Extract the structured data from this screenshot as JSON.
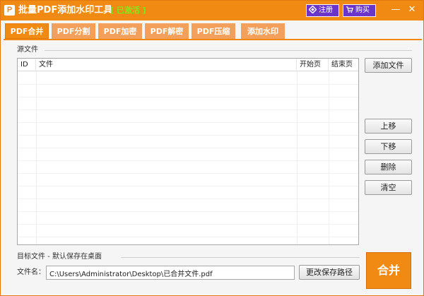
{
  "window": {
    "logo_letter": "P",
    "title": "批量PDF添加水印工具",
    "status": "[ 已激活 ]",
    "register_label": "注册",
    "buy_label": "购买",
    "minimize_glyph": "—",
    "close_glyph": "✕"
  },
  "tabs": [
    {
      "label": "PDF合并",
      "active": true
    },
    {
      "label": "PDF分割",
      "active": false
    },
    {
      "label": "PDF加密",
      "active": false
    },
    {
      "label": "PDF解密",
      "active": false
    },
    {
      "label": "PDF压缩",
      "active": false
    },
    {
      "label": "添加水印",
      "active": false
    }
  ],
  "source": {
    "group_label": "源文件",
    "columns": [
      "ID",
      "文件",
      "开始页",
      "结束页"
    ],
    "rows": []
  },
  "buttons": {
    "add_file": "添加文件",
    "move_up": "上移",
    "move_down": "下移",
    "delete": "删除",
    "clear": "清空",
    "change_path": "更改保存路径",
    "merge": "合并"
  },
  "target": {
    "group_label": "目标文件 - 默认保存在桌面",
    "file_label": "文件名：",
    "file_value": "C:\\Users\\Administrator\\Desktop\\已合并文件.pdf"
  },
  "colors": {
    "accent": "#f08a12",
    "tab_inactive": "#f3a05c",
    "title_button": "#6a35c8",
    "status_text": "#7fe81e"
  }
}
